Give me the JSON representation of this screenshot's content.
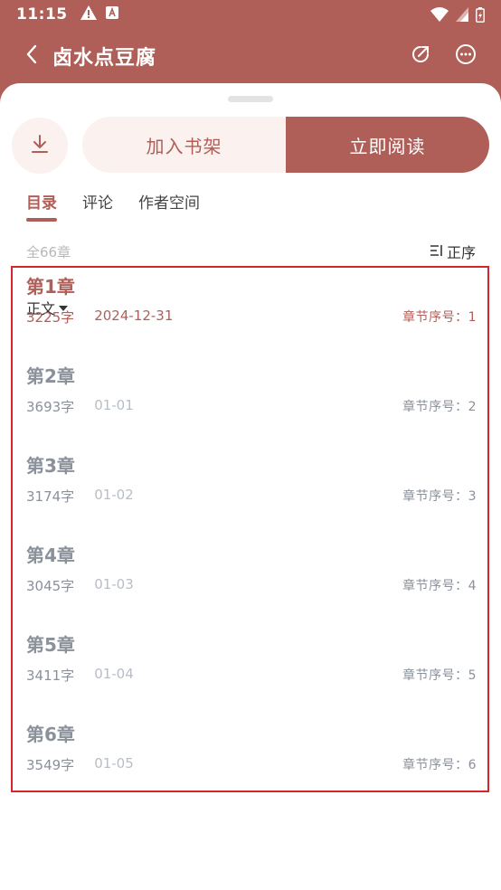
{
  "status_bar": {
    "time": "11:15",
    "icons": [
      "warning-icon",
      "a-box-icon",
      "wifi-icon",
      "signal-icon",
      "battery-icon"
    ]
  },
  "header": {
    "title": "卤水点豆腐",
    "icons": [
      "back-icon",
      "share-icon",
      "more-icon"
    ]
  },
  "actions": {
    "add_to_shelf": "加入书架",
    "read_now": "立即阅读"
  },
  "tabs": [
    {
      "label": "目录",
      "active": true
    },
    {
      "label": "评论",
      "active": false
    },
    {
      "label": "作者空间",
      "active": false
    }
  ],
  "catalog": {
    "total": "全66章",
    "sort_label": "正序",
    "volume": "正文"
  },
  "chapters": [
    {
      "title": "第1章",
      "words": "3225字",
      "date": "2024-12-31",
      "seq": "章节序号：1"
    },
    {
      "title": "第2章",
      "words": "3693字",
      "date": "01-01",
      "seq": "章节序号：2"
    },
    {
      "title": "第3章",
      "words": "3174字",
      "date": "01-02",
      "seq": "章节序号：3"
    },
    {
      "title": "第4章",
      "words": "3045字",
      "date": "01-03",
      "seq": "章节序号：4"
    },
    {
      "title": "第5章",
      "words": "3411字",
      "date": "01-04",
      "seq": "章节序号：5"
    },
    {
      "title": "第6章",
      "words": "3549字",
      "date": "01-05",
      "seq": "章节序号：6"
    }
  ],
  "colors": {
    "accent": "#b05f58",
    "accent_light": "#fbf1ef",
    "highlight_border": "#d6262d"
  }
}
